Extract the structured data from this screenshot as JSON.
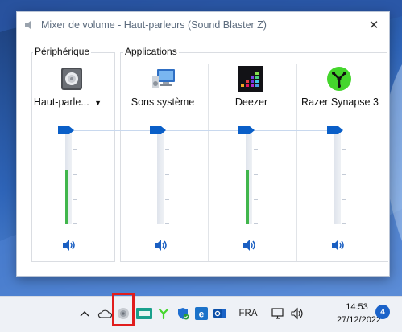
{
  "window": {
    "title": "Mixer de volume - Haut-parleurs (Sound Blaster Z)",
    "close_glyph": "✕"
  },
  "groups": {
    "device_label": "Périphérique",
    "apps_label": "Applications"
  },
  "channels": [
    {
      "name": "Haut-parle...",
      "icon": "speaker-device-icon",
      "has_dropdown": true,
      "volume_percent": 100,
      "level_percent": 55
    },
    {
      "name": "Sons système",
      "icon": "system-sounds-icon",
      "has_dropdown": false,
      "volume_percent": 100,
      "level_percent": 0
    },
    {
      "name": "Deezer",
      "icon": "deezer-icon",
      "has_dropdown": false,
      "volume_percent": 100,
      "level_percent": 55
    },
    {
      "name": "Razer Synapse 3",
      "icon": "razer-synapse-icon",
      "has_dropdown": false,
      "volume_percent": 100,
      "level_percent": 0
    }
  ],
  "taskbar": {
    "language": "FRA",
    "time": "14:53",
    "date": "27/12/2022",
    "notification_count": "4",
    "tray_icons": [
      "chevron-up-icon",
      "onedrive-icon",
      "sound-blaster-icon",
      "keyboard-app-icon",
      "razer-tray-icon",
      "defender-icon",
      "edge-icon",
      "outlook-icon"
    ]
  },
  "colors": {
    "accent": "#0a5fc8",
    "meter": "#41b64c",
    "highlight": "#e11d1d"
  }
}
